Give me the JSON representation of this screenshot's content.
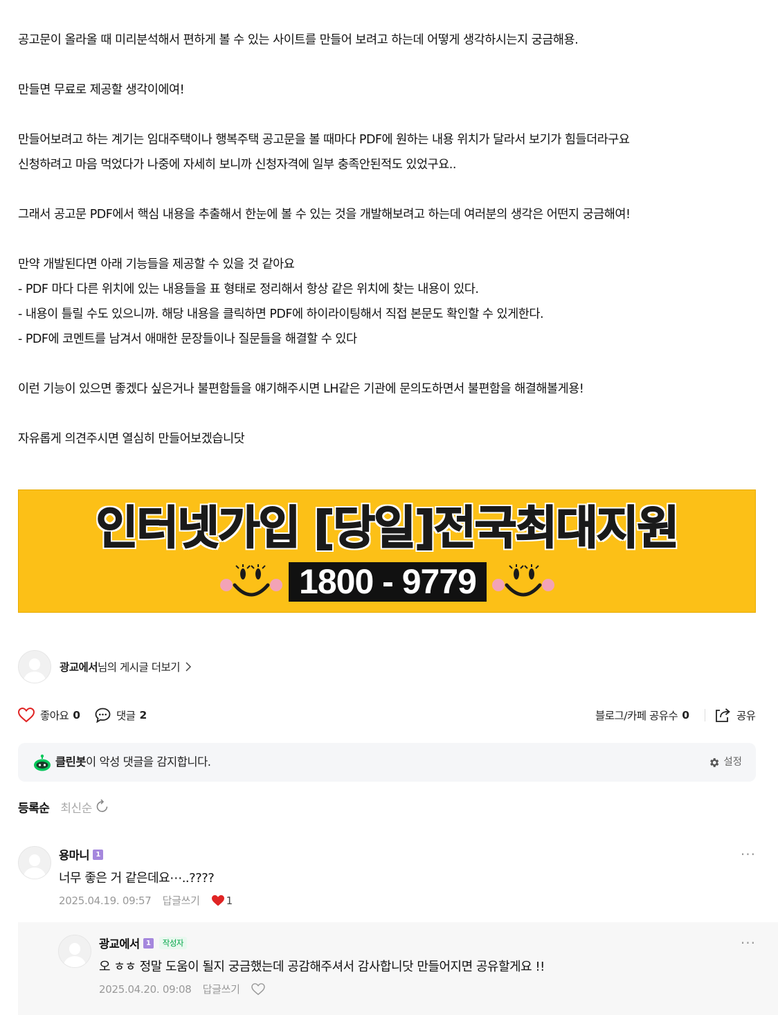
{
  "post": {
    "paragraphs": [
      "공고문이 올라올 때 미리분석해서 편하게 볼 수 있는 사이트를 만들어 보려고 하는데 어떻게 생각하시는지 궁금해용.",
      "",
      "만들면 무료로 제공할 생각이에여!",
      "",
      "만들어보려고 하는 계기는 임대주택이나 행복주택 공고문을 볼 때마다 PDF에 원하는 내용 위치가 달라서 보기가 힘들더라구요",
      "신청하려고 마음 먹었다가 나중에 자세히 보니까 신청자격에 일부 충족안된적도 있었구요..",
      "",
      "그래서 공고문 PDF에서 핵심 내용을 추출해서 한눈에 볼 수 있는 것을 개발해보려고 하는데 여러분의 생각은 어떤지 궁금해여!",
      "",
      "만약 개발된다면 아래 기능들을 제공할 수 있을 것 같아요",
      "- PDF 마다 다른 위치에 있는 내용들을 표 형태로 정리해서 항상 같은 위치에 찾는 내용이 있다.",
      "- 내용이 틀릴 수도 있으니까. 해당 내용을 클릭하면 PDF에 하이라이팅해서 직접 본문도 확인할 수 있게한다.",
      "- PDF에 코멘트를 남겨서 애매한 문장들이나 질문들을 해결할 수 있다",
      "",
      "이런 기능이 있으면 좋겠다 싶은거나 불편함들을 얘기해주시면 LH같은 기관에 문의도하면서 불편함을 해결해볼게용!",
      "",
      "자유롭게 의견주시면 열심히 만들어보겠습니닷"
    ]
  },
  "banner": {
    "title": "인터넷가입 [당일]전국최대지원",
    "phone": "1800 - 9779",
    "bg_color": "#fcc017"
  },
  "author": {
    "name": "광교에서",
    "more_text": "님의 게시글 더보기",
    "chevron_icon": "chevron-right-icon"
  },
  "actions": {
    "like_label": "좋아요",
    "like_count": "0",
    "comment_label": "댓글",
    "comment_count": "2",
    "share_count_label": "블로그/카페 공유수",
    "share_count": "0",
    "share_label": "공유"
  },
  "cleanbot": {
    "name": "클린봇",
    "text": "이 악성 댓글을 감지합니다.",
    "setting_label": "설정",
    "accent": "#03c75a"
  },
  "sort": {
    "options": [
      "등록순",
      "최신순"
    ],
    "selected": "등록순"
  },
  "comments": [
    {
      "author": "용마니",
      "level": "1",
      "body": "너무 좋은 거 같은데요⋯..????",
      "date": "2025.04.19. 09:57",
      "reply_label": "답글쓰기",
      "likes": "1",
      "liked": true
    },
    {
      "author": "광교에서",
      "level": "1",
      "badge": "작성자",
      "body": "오 ㅎㅎ 정말 도움이 될지 궁금했는데 공감해주셔서 감사합니닷 만들어지면 공유할게요 !!",
      "date": "2025.04.20. 09:08",
      "reply_label": "답글쓰기",
      "liked": false
    }
  ],
  "more_label": "···"
}
